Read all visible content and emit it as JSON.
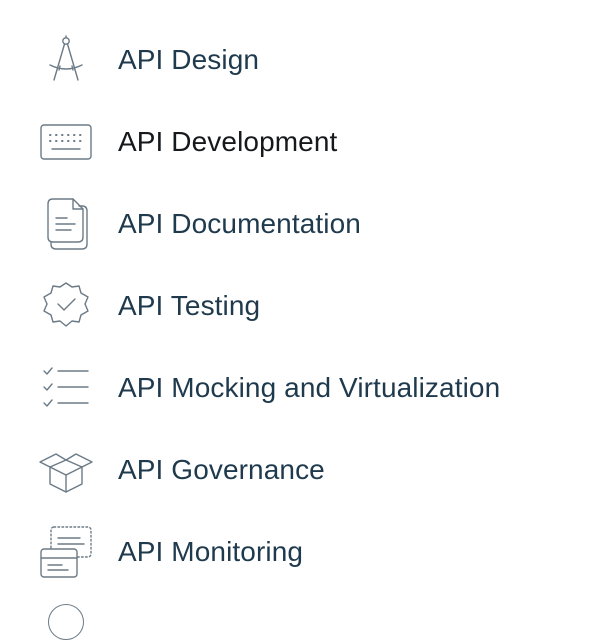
{
  "menu": {
    "items": [
      {
        "label": "API Design",
        "icon": "compass-icon"
      },
      {
        "label": "API Development",
        "icon": "keyboard-icon"
      },
      {
        "label": "API Documentation",
        "icon": "document-icon"
      },
      {
        "label": "API Testing",
        "icon": "badge-check-icon"
      },
      {
        "label": "API Mocking and Virtualization",
        "icon": "checklist-icon"
      },
      {
        "label": "API Governance",
        "icon": "open-box-icon"
      },
      {
        "label": "API Monitoring",
        "icon": "monitor-cards-icon"
      }
    ]
  },
  "colors": {
    "icon_stroke": "#6b7a86",
    "label_text": "#1f3a4d",
    "active_label_text": "#15191c",
    "background": "#ffffff"
  }
}
